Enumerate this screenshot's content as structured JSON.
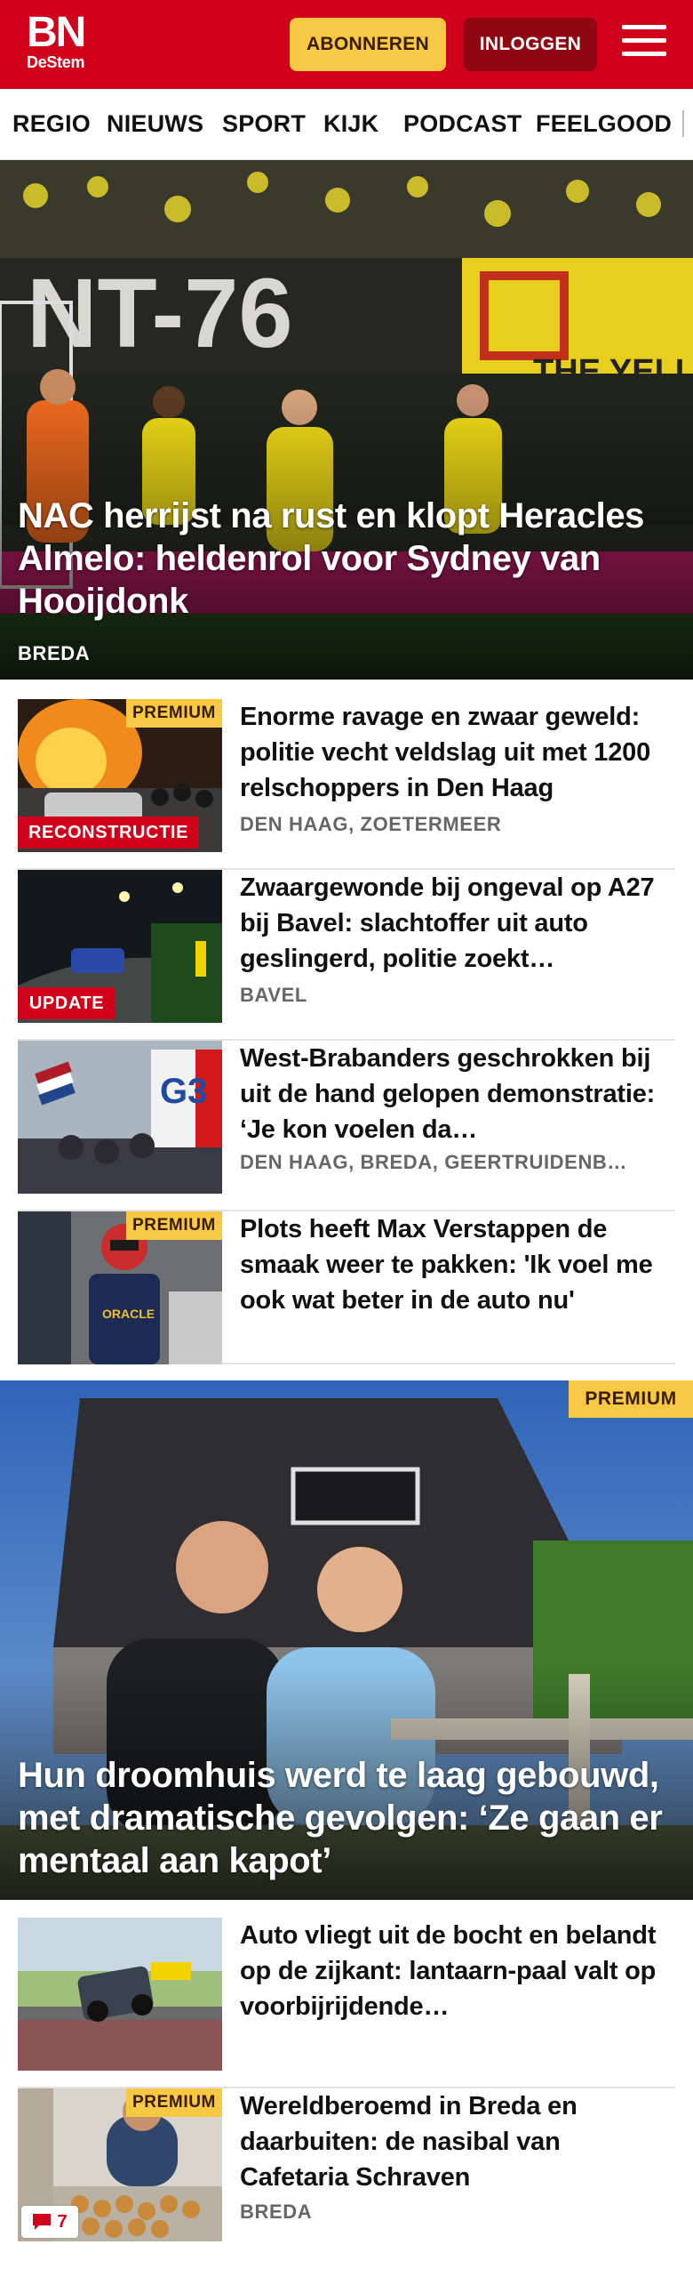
{
  "header": {
    "logo_main": "BN",
    "logo_sub": "DeStem",
    "subscribe_label": "ABONNEREN",
    "login_label": "INLOGGEN",
    "brand_color": "#d0021b"
  },
  "nav": {
    "items": [
      "REGIO",
      "NIEUWS",
      "SPORT",
      "KIJK",
      "PODCAST",
      "FEELGOOD"
    ]
  },
  "hero": {
    "title": "NAC herrijst na rust en klopt Heracles Almelo: heldenrol voor Sydney van Hooijdonk",
    "location": "BREDA"
  },
  "articles": [
    {
      "title": "Enorme ravage en zwaar geweld: politie vecht veldslag uit met 1200 relschoppers in Den Haag",
      "location": "DEN HAAG, ZOETERMEER",
      "premium": "PREMIUM",
      "tag": "RECONSTRUCTIE"
    },
    {
      "title": "Zwaargewonde bij ongeval op A27 bij Bavel: slachtoffer uit auto geslingerd, politie zoekt…",
      "location": "BAVEL",
      "tag": "UPDATE"
    },
    {
      "title": "West-Brabanders geschrokken bij uit de hand gelopen demonstratie: ‘Je kon voelen da…",
      "location": "DEN HAAG, BREDA, GEERTRUIDENB…"
    },
    {
      "title": "Plots heeft Max Verstappen de smaak weer te pakken: 'Ik voel me ook wat beter in de auto nu'",
      "premium": "PREMIUM"
    }
  ],
  "feature": {
    "title": "Hun droomhuis werd te laag gebouwd, met dramatische gevolgen: ‘Ze gaan er mentaal aan kapot’",
    "premium": "PREMIUM"
  },
  "articles_bottom": [
    {
      "title": "Auto vliegt uit de bocht en belandt op de zijkant: lantaarn-paal valt op voorbijrijdende…"
    },
    {
      "title": "Wereldberoemd in Breda en daarbuiten: de nasibal van Cafetaria Schraven",
      "location": "BREDA",
      "premium": "PREMIUM",
      "comments": "7"
    }
  ]
}
